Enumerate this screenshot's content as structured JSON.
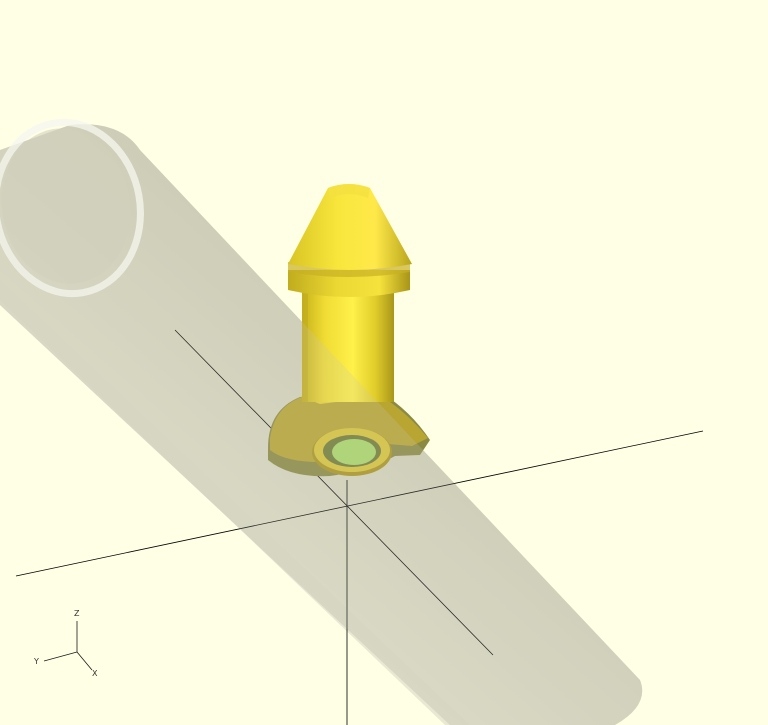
{
  "viewport": {
    "background": "#ffffe5",
    "axis_color": "#000000"
  },
  "model": {
    "part_color": "#f2e43a",
    "part_shadow": "#b3a317",
    "inner_bore_color": "#a9d86a",
    "tube_color": "#c8c8b4",
    "tube_opacity": 0.55
  },
  "axes_gizmo": {
    "z_label": "Z",
    "y_label": "Y",
    "x_label": "X"
  }
}
